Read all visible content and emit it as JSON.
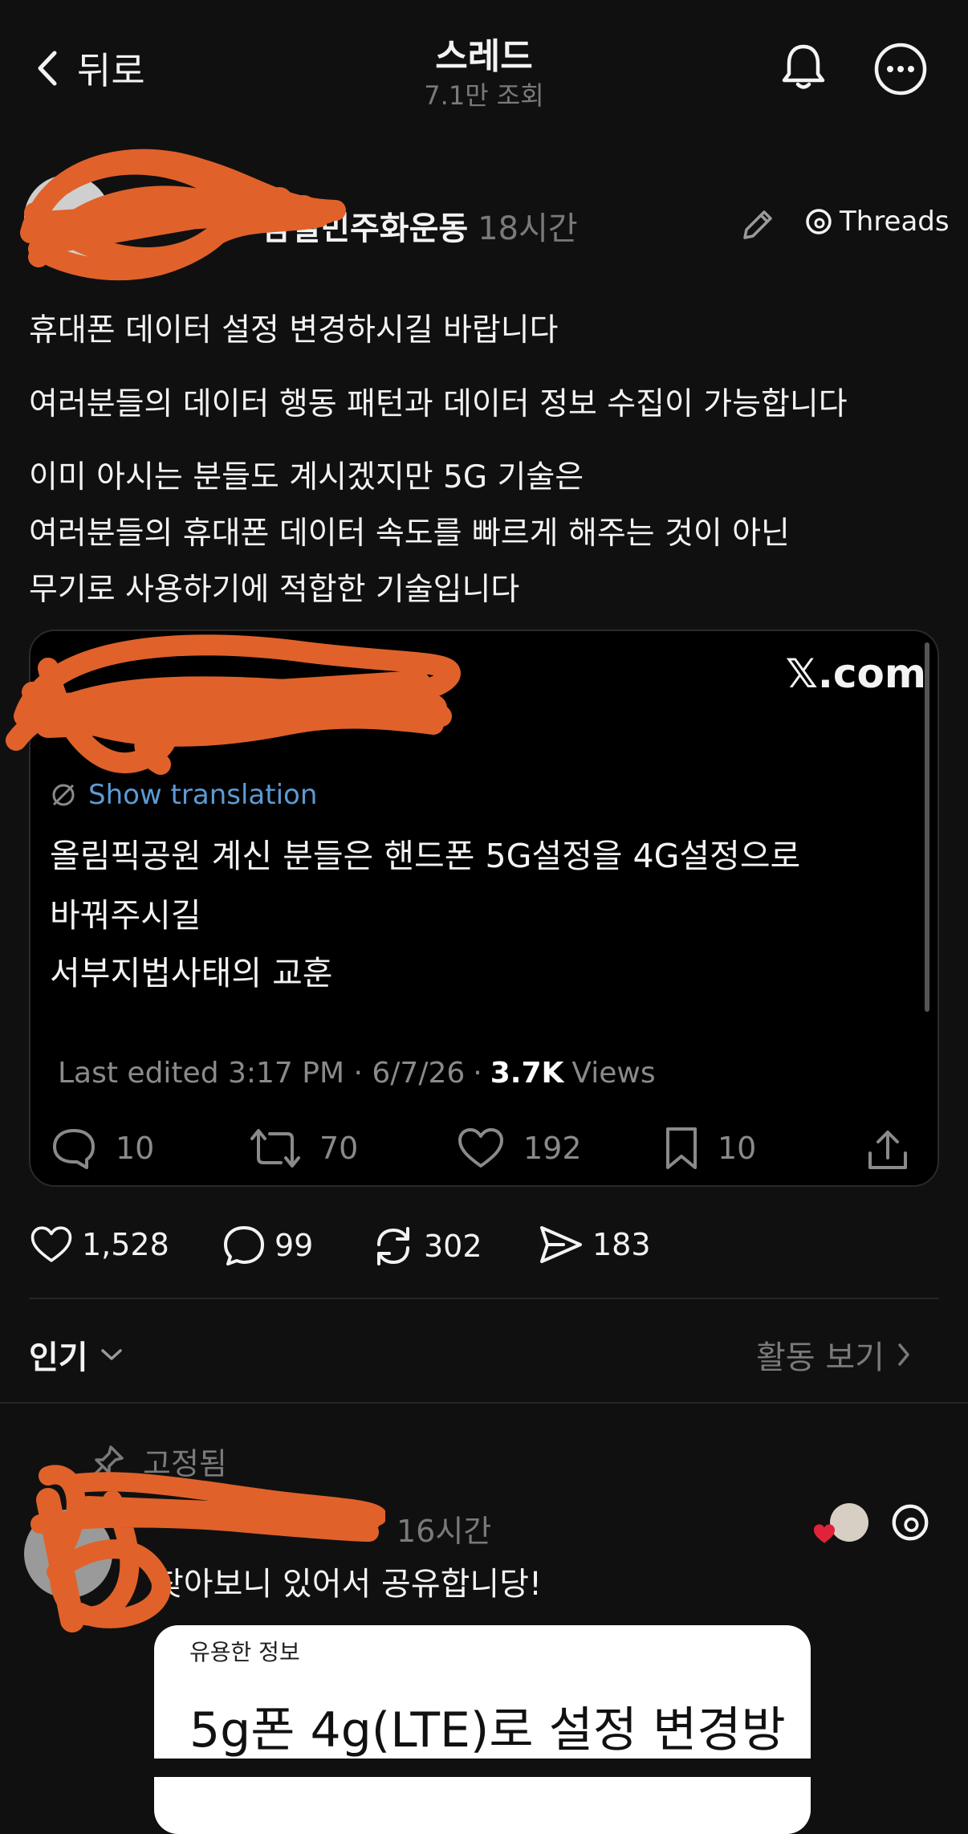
{
  "header": {
    "back_label": "뒤로",
    "title": "스레드",
    "views": "7.1만 조회"
  },
  "post": {
    "author_name": "잠실민주화운동",
    "time": "18시간",
    "platform_label": "Threads",
    "lines": [
      "휴대폰 데이터 설정 변경하시길 바랍니다",
      "여러분들의 데이터 행동 패턴과 데이터 정보 수집이 가능합니다",
      "이미 아시는 분들도 계시겠지만  5G 기술은",
      "여러분들의 휴대폰 데이터 속도를 빠르게 해주는 것이 아닌",
      "무기로 사용하기에 적합한 기술입니다"
    ]
  },
  "embed": {
    "source": "𝕏.com",
    "translate_label": "Show translation",
    "lines": [
      "올림픽공원 계신 분들은 핸드폰 5G설정을 4G설정으로",
      "바꿔주시길",
      "서부지법사태의 교훈"
    ],
    "edited": "Last edited 3:17 PM · 6/7/26",
    "views_count": "3.7K",
    "views_label": "Views",
    "stats": {
      "replies": "10",
      "reposts": "70",
      "likes": "192",
      "bookmarks": "10"
    }
  },
  "actions": {
    "likes": "1,528",
    "comments": "99",
    "reposts": "302",
    "shares": "183"
  },
  "sort": {
    "label": "인기",
    "activity_label": "활동 보기"
  },
  "reply": {
    "pinned_label": "고정됨",
    "time": "16시간",
    "text": "찾아보니 있어서 공유합니당!",
    "card_label": "유용한 정보",
    "card_title": "5g폰 4g(LTE)로 설정 변경방"
  },
  "colors": {
    "background": "#101010",
    "scribble": "#e0622a",
    "link": "#5b9bd5",
    "like_red": "#e0233a"
  }
}
